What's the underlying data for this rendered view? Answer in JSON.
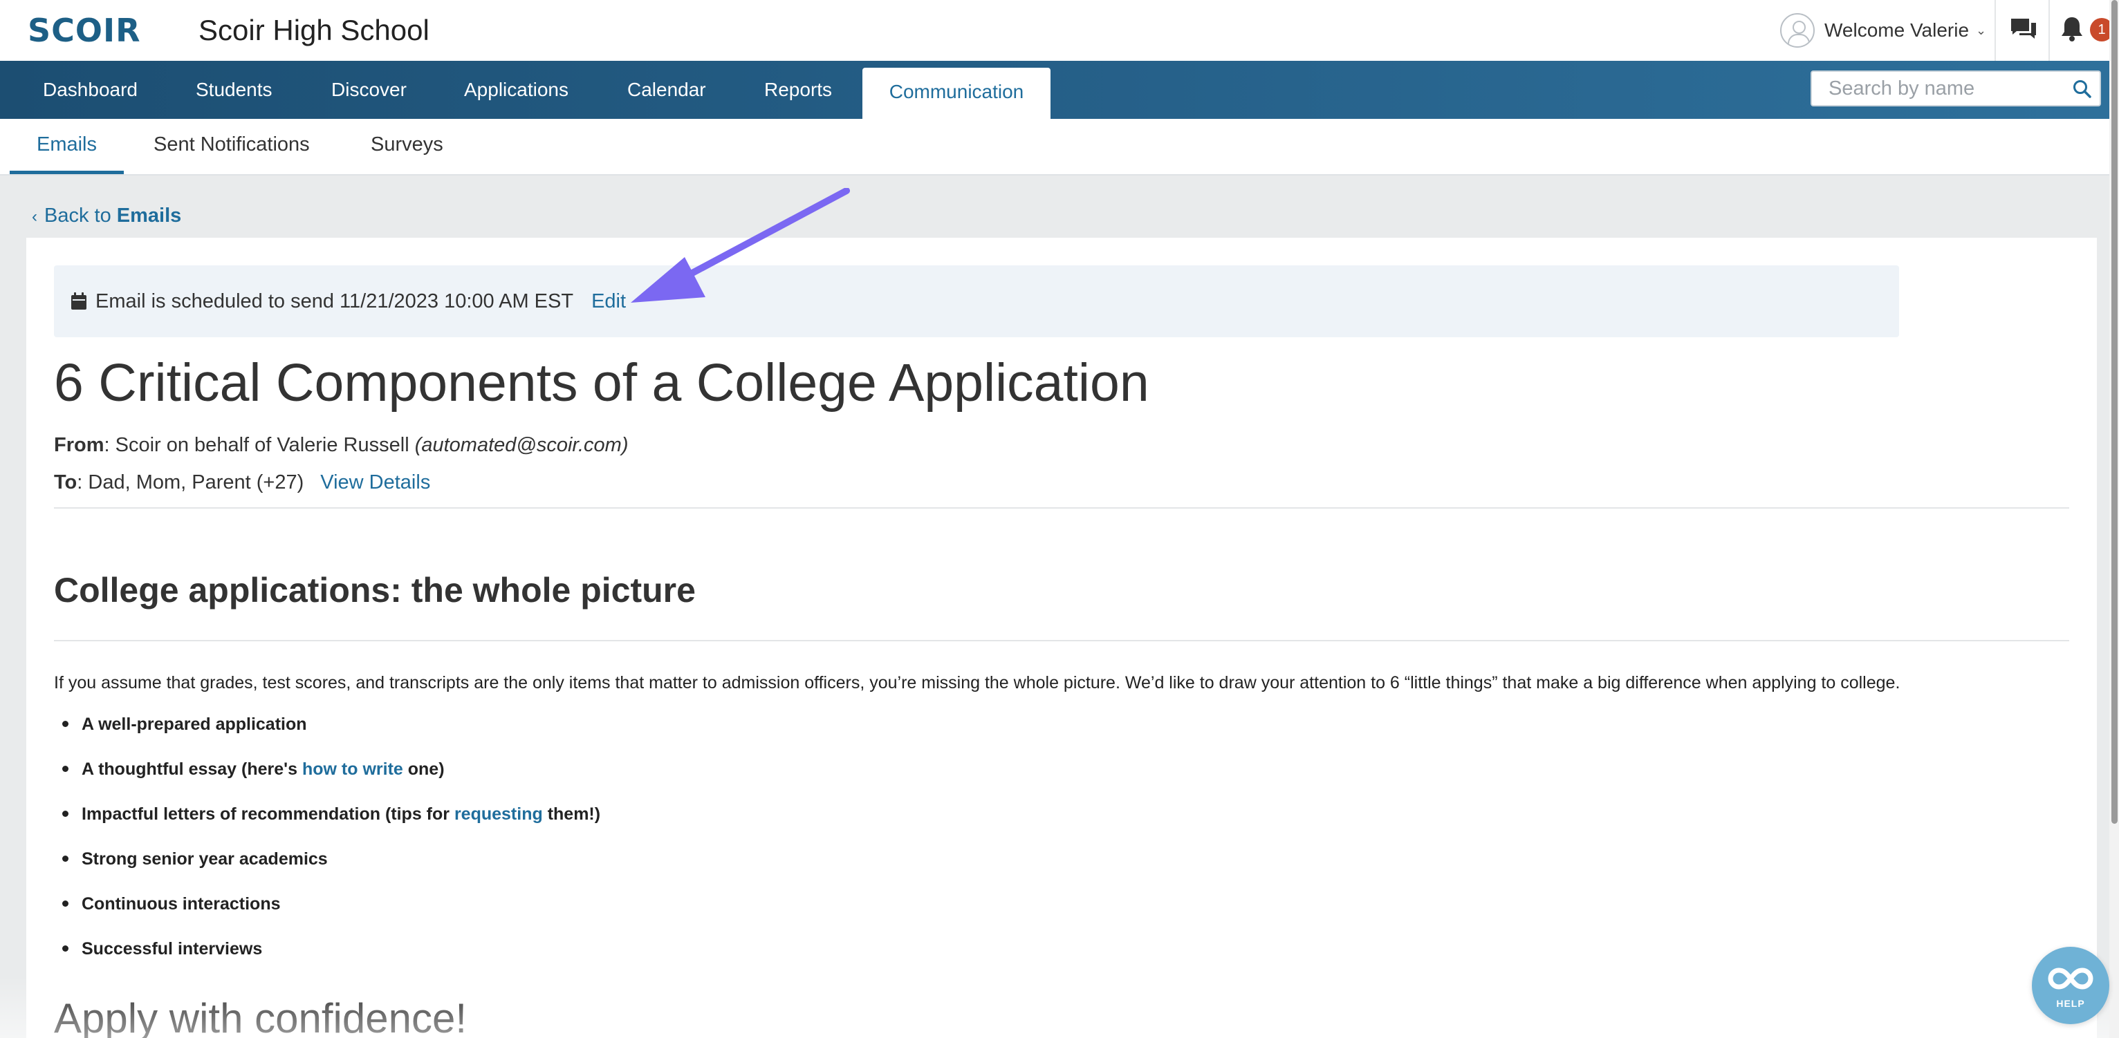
{
  "header": {
    "logo": "SCOIR",
    "school_name": "Scoir High School",
    "welcome": "Welcome Valerie",
    "notification_count": "1"
  },
  "nav": {
    "items": [
      "Dashboard",
      "Students",
      "Discover",
      "Applications",
      "Calendar",
      "Reports",
      "Communication"
    ],
    "active": "Communication",
    "search_placeholder": "Search by name"
  },
  "subnav": {
    "items": [
      "Emails",
      "Sent Notifications",
      "Surveys"
    ],
    "active": "Emails"
  },
  "back": {
    "prefix": "Back to",
    "target": "Emails"
  },
  "schedule": {
    "text": "Email is scheduled to send 11/21/2023 10:00 AM EST",
    "edit_label": "Edit"
  },
  "email": {
    "title": "6 Critical Components of a College Application",
    "from_label": "From",
    "from_value": ": Scoir on behalf of Valerie Russell",
    "from_address": "(automated@scoir.com)",
    "to_label": "To",
    "to_value": ": Dad, Mom, Parent (+27)",
    "view_details": "View Details",
    "body": {
      "heading": "College applications: the whole picture",
      "intro": "If you assume that grades, test scores, and transcripts are the only items that matter to admission officers, you’re missing the whole picture. We’d like to draw your attention to 6 “little things” that make a big difference when applying to college.",
      "bullet_1": "A well-prepared application",
      "bullet_2_pre": "A thoughtful essay (here's ",
      "bullet_2_link": "how to write",
      "bullet_2_post": " one)",
      "bullet_3_pre": "Impactful letters of recommendation (tips for ",
      "bullet_3_link": "requesting",
      "bullet_3_post": " them!)",
      "bullet_4": "Strong senior year academics",
      "bullet_5": "Continuous interactions",
      "bullet_6": "Successful interviews",
      "heading_2": "Apply with confidence!"
    }
  },
  "help": {
    "label": "HELP"
  },
  "colors": {
    "brand": "#1d5f86",
    "link": "#1f6d9c",
    "nav_start": "#1c4e72",
    "nav_end": "#2e709b",
    "badge": "#c94a2b",
    "annotation_arrow": "#7b68f2"
  },
  "icons": [
    "avatar-icon",
    "chat-icon",
    "bell-icon",
    "search-icon",
    "chevron-left-icon",
    "calendar-icon",
    "arrow-annotation",
    "help-icon"
  ]
}
